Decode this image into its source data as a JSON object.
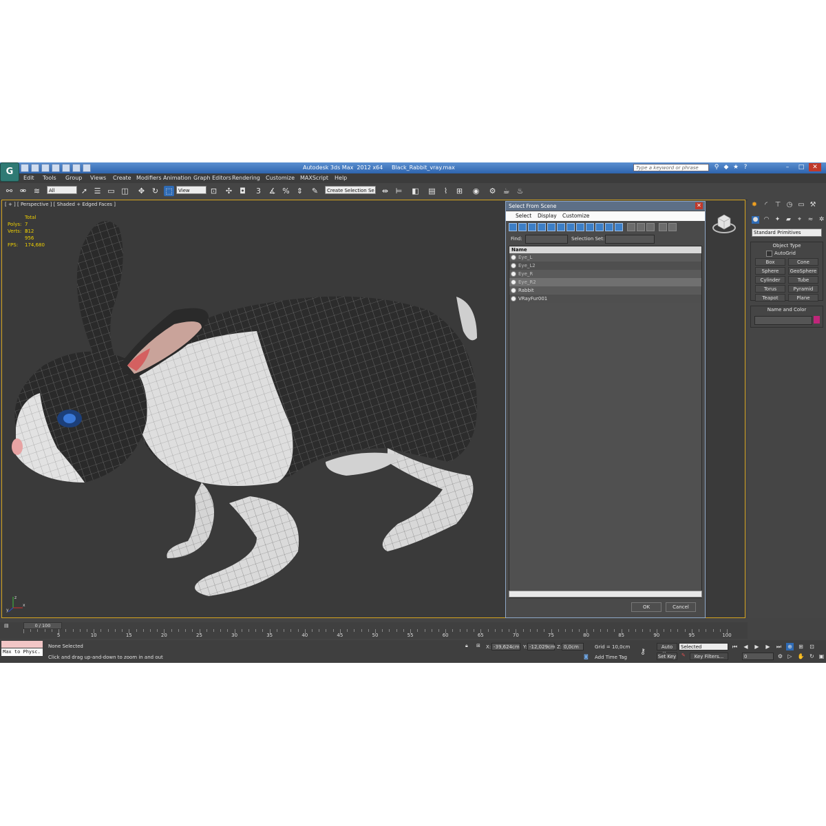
{
  "app": {
    "logo": "G",
    "title": "Autodesk 3ds Max  2012 x64     Black_Rabbit_vray.max",
    "search_placeholder": "Type a keyword or phrase"
  },
  "menu": [
    "Edit",
    "Tools",
    "Group",
    "Views",
    "Create",
    "Modifiers",
    "Animation",
    "Graph Editors",
    "Rendering",
    "Customize",
    "MAXScript",
    "Help"
  ],
  "toolbar": {
    "filter_value": "All",
    "coord_system": "View",
    "named_selection": "Create Selection Se",
    "snap_labels": [
      "3",
      "%"
    ]
  },
  "viewport": {
    "label": "[ + ] [ Perspective ] [ Shaded + Edged Faces ]",
    "stats": {
      "total_label": "Total",
      "polys_label": "Polys:",
      "polys_value": "7 812",
      "verts_label": "Verts:",
      "verts_value": "3 956",
      "fps_label": "FPS:",
      "fps_value": "174,680"
    },
    "axis_labels": [
      "z",
      "x",
      "y"
    ]
  },
  "dialog": {
    "title": "Select From Scene",
    "menu": [
      "Select",
      "Display",
      "Customize"
    ],
    "find_label": "Find:",
    "selection_set_label": "Selection Set:",
    "column_header": "Name",
    "objects": [
      "Eye_L",
      "Eye_L2",
      "Eye_R",
      "Eye_R2",
      "Rabbit",
      "VRayFur001"
    ],
    "ok_label": "OK",
    "cancel_label": "Cancel"
  },
  "command_panel": {
    "category": "Standard Primitives",
    "object_type_title": "Object Type",
    "autogrid_label": "AutoGrid",
    "primitives": [
      "Box",
      "Cone",
      "Sphere",
      "GeoSphere",
      "Cylinder",
      "Tube",
      "Torus",
      "Pyramid",
      "Teapot",
      "Plane"
    ],
    "name_color_title": "Name and Color",
    "object_color": "#c0267a"
  },
  "timeline": {
    "slider_label": "0 / 100",
    "ticks": [
      "5",
      "10",
      "15",
      "20",
      "25",
      "30",
      "35",
      "40",
      "45",
      "50",
      "55",
      "60",
      "65",
      "70",
      "75",
      "80",
      "85",
      "90",
      "95",
      "100"
    ]
  },
  "status": {
    "script_listener": "Max to Physc.",
    "selection_status": "None Selected",
    "prompt": "Click and drag up-and-down to zoom in and out",
    "x_label": "X:",
    "x_value": "-39,624cm",
    "y_label": "Y:",
    "y_value": "-12,029cm",
    "z_label": "Z:",
    "z_value": "0,0cm",
    "grid": "Grid = 10,0cm",
    "add_time_tag": "Add Time Tag",
    "auto_key": "Auto Key",
    "set_key": "Set Key",
    "key_mode": "Selected",
    "key_filters": "Key Filters...",
    "frame": "0"
  }
}
